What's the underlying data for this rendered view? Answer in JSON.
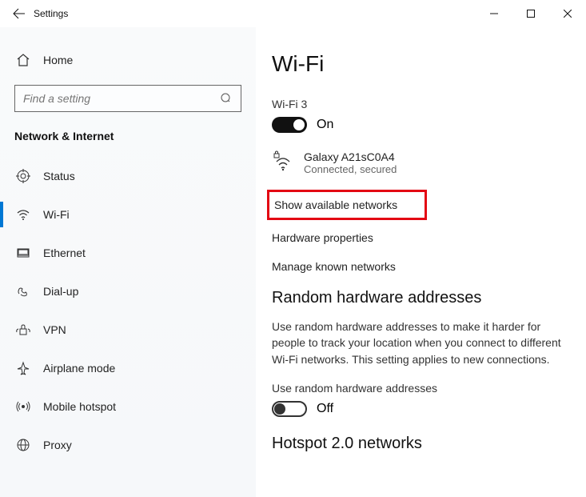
{
  "titlebar": {
    "title": "Settings"
  },
  "sidebar": {
    "home_label": "Home",
    "search_placeholder": "Find a setting",
    "section_title": "Network & Internet",
    "items": [
      {
        "label": "Status"
      },
      {
        "label": "Wi-Fi"
      },
      {
        "label": "Ethernet"
      },
      {
        "label": "Dial-up"
      },
      {
        "label": "VPN"
      },
      {
        "label": "Airplane mode"
      },
      {
        "label": "Mobile hotspot"
      },
      {
        "label": "Proxy"
      }
    ]
  },
  "content": {
    "title": "Wi-Fi",
    "adapter_name": "Wi-Fi 3",
    "adapter_toggle_label": "On",
    "connected_network": {
      "name": "Galaxy A21sC0A4",
      "status": "Connected, secured"
    },
    "links": {
      "show_available": "Show available networks",
      "hardware_properties": "Hardware properties",
      "manage_known": "Manage known networks"
    },
    "random_hw": {
      "heading": "Random hardware addresses",
      "description": "Use random hardware addresses to make it harder for people to track your location when you connect to different Wi-Fi networks. This setting applies to new connections.",
      "toggle_label": "Use random hardware addresses",
      "toggle_state": "Off"
    },
    "hotspot": {
      "heading": "Hotspot 2.0 networks"
    }
  }
}
